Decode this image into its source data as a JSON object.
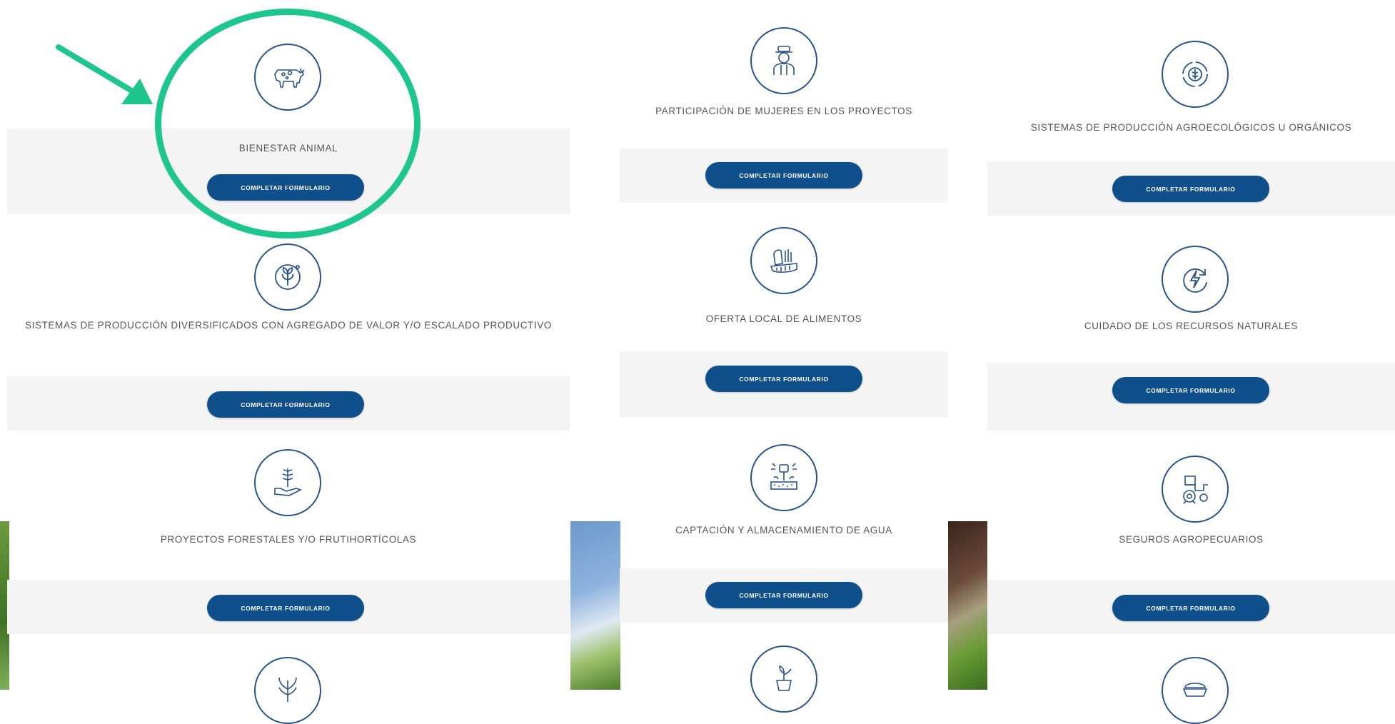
{
  "colors": {
    "accent": "#0e4f8c",
    "icon_stroke": "#28538a",
    "highlight": "#1ec68e",
    "band": "#f4f4f5"
  },
  "columns": [
    {
      "items": [
        {
          "title": "BIENESTAR ANIMAL",
          "icon": "cow-icon",
          "button": "COMPLETAR FORMULARIO"
        },
        {
          "title": "SISTEMAS DE PRODUCCIÓN DIVERSIFICADOS CON AGREGADO DE VALOR Y/O ESCALADO PRODUCTIVO",
          "icon": "diversified-leaf-icon",
          "button": "COMPLETAR FORMULARIO"
        },
        {
          "title": "PROYECTOS FORESTALES Y/O FRUTIHORTÍCOLAS",
          "icon": "hand-plant-icon",
          "button": "COMPLETAR FORMULARIO"
        },
        {
          "icon": "plant-icon"
        }
      ]
    },
    {
      "items": [
        {
          "title": "PARTICIPACIÓN DE MUJERES EN LOS PROYECTOS",
          "icon": "woman-farmer-icon",
          "button": "COMPLETAR FORMULARIO"
        },
        {
          "title": "OFERTA LOCAL DE ALIMENTOS",
          "icon": "produce-basket-icon",
          "button": "COMPLETAR FORMULARIO"
        },
        {
          "title": "CAPTACIÓN Y ALMACENAMIENTO DE AGUA",
          "icon": "irrigation-icon",
          "button": "COMPLETAR FORMULARIO"
        },
        {
          "icon": "seedling-pot-icon"
        }
      ]
    },
    {
      "items": [
        {
          "title": "SISTEMAS DE PRODUCCIÓN AGROECOLÓGICOS U ORGÁNICOS",
          "icon": "organic-cycle-icon",
          "button": "COMPLETAR FORMULARIO"
        },
        {
          "title": "CUIDADO DE LOS RECURSOS NATURALES",
          "icon": "energy-cycle-icon",
          "button": "COMPLETAR FORMULARIO"
        },
        {
          "title": "SEGUROS AGROPECUARIOS",
          "icon": "tractor-icon",
          "button": "COMPLETAR FORMULARIO"
        },
        {
          "icon": "grain-bowl-icon"
        }
      ]
    }
  ]
}
